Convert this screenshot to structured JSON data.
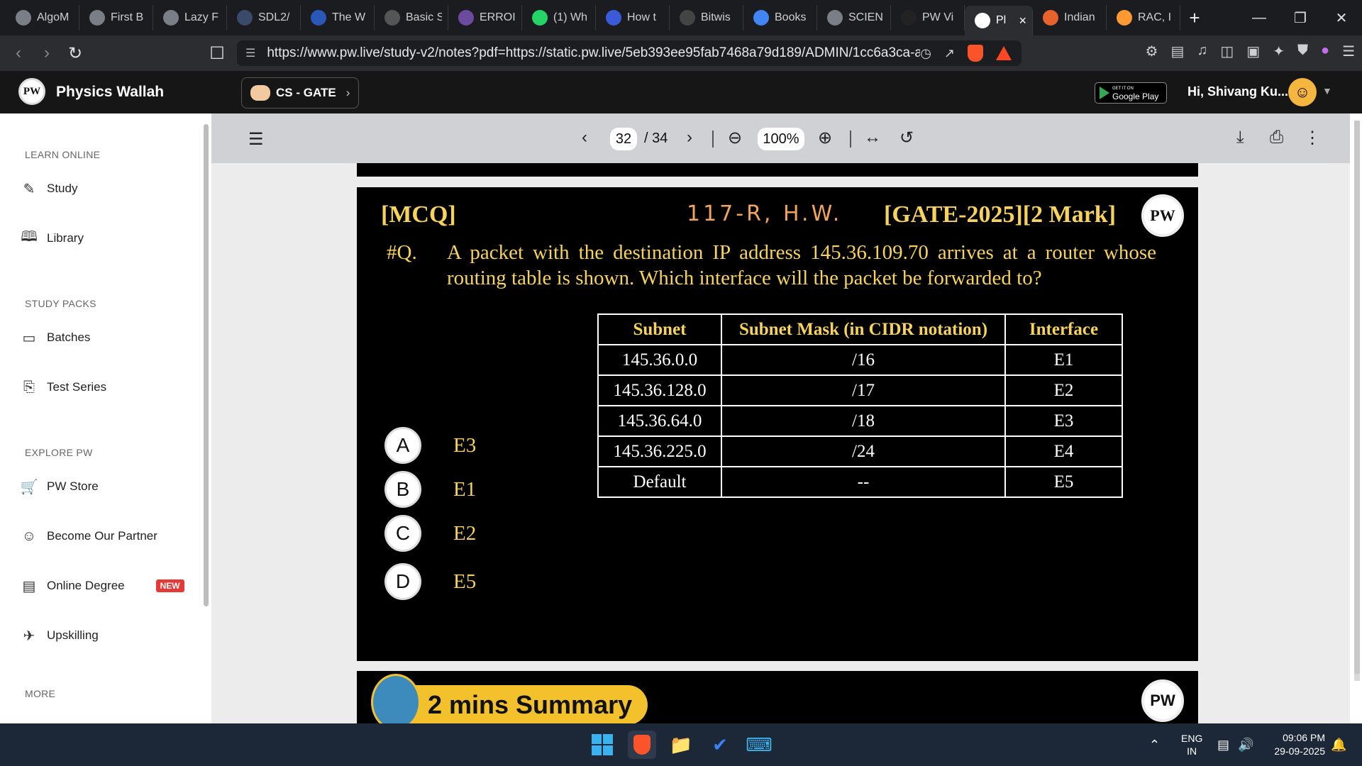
{
  "tabs": [
    {
      "label": "AlgoM",
      "color": "#7a7f87"
    },
    {
      "label": "First B",
      "color": "#7a7f87"
    },
    {
      "label": "Lazy F",
      "color": "#7a7f87"
    },
    {
      "label": "SDL2/",
      "color": "#3b4a6b"
    },
    {
      "label": "The W",
      "color": "#2a58b8"
    },
    {
      "label": "Basic S",
      "color": "#555555"
    },
    {
      "label": "ERROI",
      "color": "#6b4aa0"
    },
    {
      "label": "(1) Wh",
      "color": "#25d366"
    },
    {
      "label": "How t",
      "color": "#3a5ad9"
    },
    {
      "label": "Bitwis",
      "color": "#444444"
    },
    {
      "label": "Books",
      "color": "#4285f4"
    },
    {
      "label": "SCIEN",
      "color": "#7a7f87"
    },
    {
      "label": "PW Vi",
      "color": "#222222"
    },
    {
      "label": "Pl",
      "color": "#ffffff",
      "active": true
    },
    {
      "label": "Indian",
      "color": "#e8622c"
    },
    {
      "label": "RAC, I",
      "color": "#ff9933"
    }
  ],
  "browser": {
    "url": "https://www.pw.live/study-v2/notes?pdf=https://static.pw.live/5eb393ee95fab7468a79d189/ADMIN/1cc6a3ca-a..."
  },
  "header": {
    "brand": "Physics Wallah",
    "logo_text": "PW",
    "course": "CS - GATE",
    "gplay_small": "GET IT ON",
    "gplay_big": "Google Play",
    "greeting": "Hi, Shivang Ku..."
  },
  "sidebar": {
    "sections": [
      {
        "heading": "LEARN ONLINE",
        "items": [
          {
            "label": "Study",
            "icon": "edit-icon"
          },
          {
            "label": "Library",
            "icon": "book-icon"
          }
        ]
      },
      {
        "heading": "STUDY PACKS",
        "items": [
          {
            "label": "Batches",
            "icon": "monitor-icon"
          },
          {
            "label": "Test Series",
            "icon": "clipboard-icon"
          }
        ]
      },
      {
        "heading": "EXPLORE PW",
        "items": [
          {
            "label": "PW Store",
            "icon": "cart-icon"
          },
          {
            "label": "Become Our Partner",
            "icon": "partner-icon"
          },
          {
            "label": "Online Degree",
            "icon": "degree-icon",
            "badge": "NEW"
          },
          {
            "label": "Upskilling",
            "icon": "rocket-icon"
          }
        ]
      },
      {
        "heading": "MORE",
        "items": []
      }
    ]
  },
  "pdf_toolbar": {
    "page": "32",
    "total": "/ 34",
    "zoom": "100%"
  },
  "slide": {
    "tag": "[MCQ]",
    "handwritten": "117-R, H.W.",
    "exam": "[GATE-2025][2 Mark]",
    "qno": "#Q.",
    "question": "A packet with the destination IP address 145.36.109.70 arrives at a router whose routing table is shown. Which interface will the packet be forwarded to?",
    "table": {
      "headers": [
        "Subnet",
        "Subnet Mask (in CIDR notation)",
        "Interface"
      ],
      "rows": [
        [
          "145.36.0.0",
          "/16",
          "E1"
        ],
        [
          "145.36.128.0",
          "/17",
          "E2"
        ],
        [
          "145.36.64.0",
          "/18",
          "E3"
        ],
        [
          "145.36.225.0",
          "/24",
          "E4"
        ],
        [
          "Default",
          "--",
          "E5"
        ]
      ]
    },
    "options": [
      {
        "letter": "A",
        "text": "E3"
      },
      {
        "letter": "B",
        "text": "E1"
      },
      {
        "letter": "C",
        "text": "E2"
      },
      {
        "letter": "D",
        "text": "E5"
      }
    ]
  },
  "next_slide": {
    "title": "2 mins Summary"
  },
  "taskbar": {
    "lang": "ENG",
    "region": "IN",
    "time": "09:06 PM",
    "date": "29-09-2025"
  }
}
